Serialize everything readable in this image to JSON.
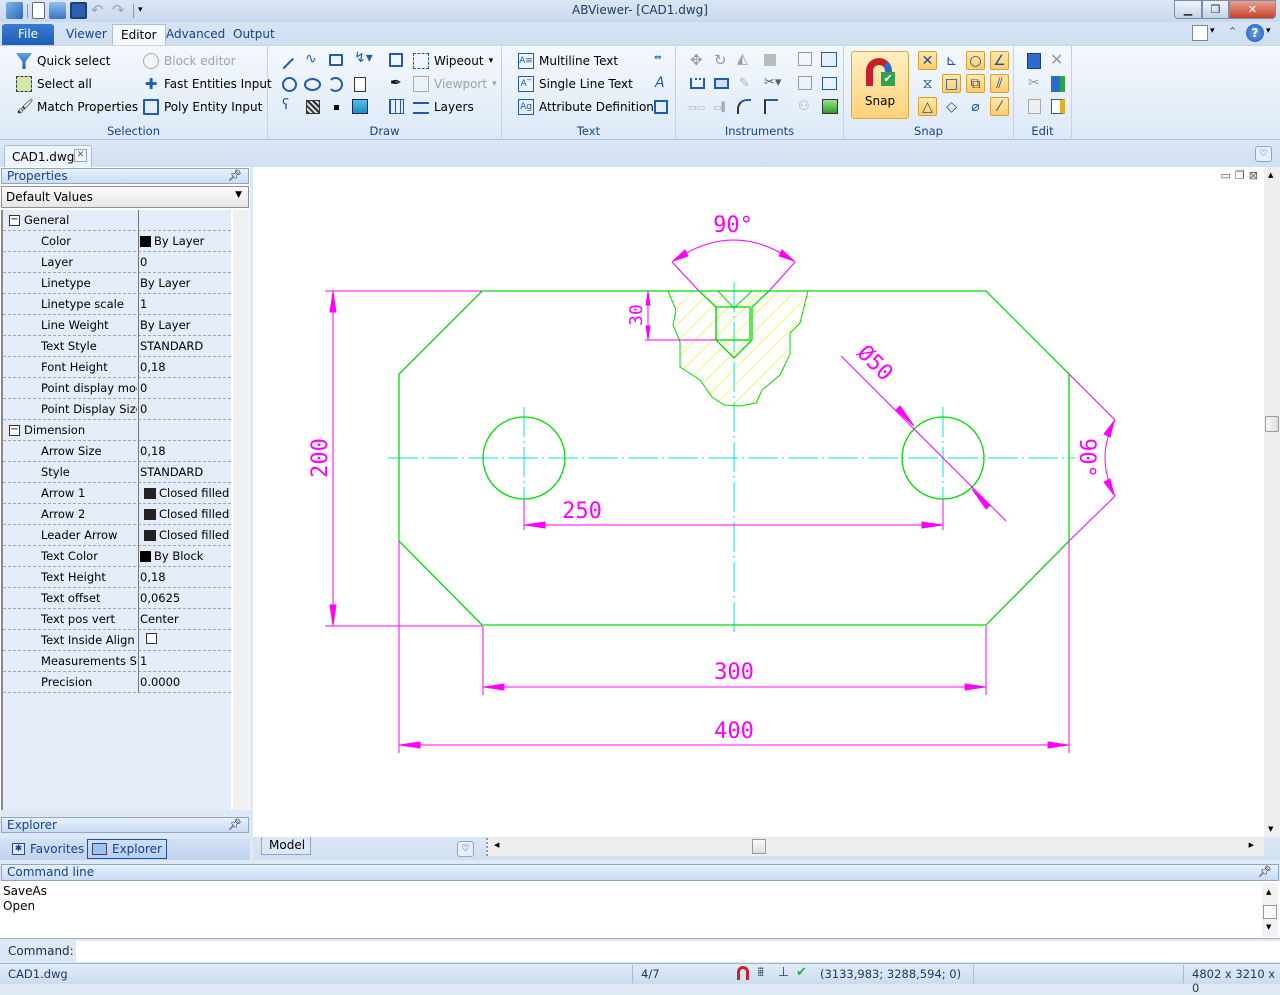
{
  "window": {
    "title": "ABViewer- [CAD1.dwg]",
    "controls": [
      "minimize",
      "restore",
      "close"
    ]
  },
  "quick_access": [
    "app-icon",
    "new-icon",
    "open-icon",
    "save-icon",
    "undo-icon",
    "redo-icon",
    "customize-icon"
  ],
  "ribbon_tabs": [
    {
      "label": "File"
    },
    {
      "label": "Viewer"
    },
    {
      "label": "Editor",
      "active": true
    },
    {
      "label": "Advanced"
    },
    {
      "label": "Output"
    }
  ],
  "ribbon": {
    "selection": {
      "label": "Selection",
      "items": [
        {
          "label": "Quick select",
          "icon": "filter-icon"
        },
        {
          "label": "Select all",
          "icon": "select-all-icon"
        },
        {
          "label": "Match Properties",
          "icon": "brush-icon"
        },
        {
          "label": "Block editor",
          "icon": "block-editor-icon",
          "disabled": true
        },
        {
          "label": "Fast Entities Input",
          "icon": "plus-icon"
        },
        {
          "label": "Poly Entity Input",
          "icon": "poly-input-icon"
        }
      ]
    },
    "draw": {
      "label": "Draw",
      "items": [
        {
          "label": "Wipeout",
          "icon": "wipeout-icon"
        },
        {
          "label": "Viewport",
          "icon": "viewport-icon",
          "disabled": true
        },
        {
          "label": "Layers",
          "icon": "layers-icon"
        }
      ]
    },
    "text": {
      "label": "Text",
      "items": [
        {
          "label": "Multiline Text",
          "icon": "mtext-icon"
        },
        {
          "label": "Single Line Text",
          "icon": "stext-icon"
        },
        {
          "label": "Attribute Definition",
          "icon": "attdef-icon"
        }
      ]
    },
    "instruments": {
      "label": "Instruments"
    },
    "snap": {
      "label": "Snap",
      "button": "Snap",
      "modes": [
        {
          "name": "intersection",
          "glyph": "✕",
          "on": true
        },
        {
          "name": "perpendicular",
          "glyph": "⊾",
          "on": false
        },
        {
          "name": "center",
          "glyph": "○",
          "on": true
        },
        {
          "name": "angle",
          "glyph": "∠",
          "on": true
        },
        {
          "name": "midpoint",
          "glyph": "⧖",
          "on": false
        },
        {
          "name": "square",
          "glyph": "□",
          "on": true
        },
        {
          "name": "overlap",
          "glyph": "⧉",
          "on": true
        },
        {
          "name": "parallel",
          "glyph": "⫽",
          "on": true
        },
        {
          "name": "triangle",
          "glyph": "△",
          "on": true
        },
        {
          "name": "quadrant",
          "glyph": "◇",
          "on": false
        },
        {
          "name": "tangent",
          "glyph": "⌀",
          "on": false
        },
        {
          "name": "nearest",
          "glyph": "⁄",
          "on": true
        }
      ]
    },
    "edit": {
      "label": "Edit"
    }
  },
  "document_tab": {
    "label": "CAD1.dwg"
  },
  "properties": {
    "title": "Properties",
    "selector": "Default Values",
    "categories": [
      {
        "name": "General",
        "rows": [
          {
            "key": "Color",
            "value": "By Layer",
            "swatch": "#000000"
          },
          {
            "key": "Layer",
            "value": "0"
          },
          {
            "key": "Linetype",
            "value": "By Layer"
          },
          {
            "key": "Linetype scale",
            "value": "1"
          },
          {
            "key": "Line Weight",
            "value": "By Layer"
          },
          {
            "key": "Text Style",
            "value": "STANDARD"
          },
          {
            "key": "Font Height",
            "value": "0,18"
          },
          {
            "key": "Point display mode",
            "value": "0"
          },
          {
            "key": "Point Display Size",
            "value": "0"
          }
        ]
      },
      {
        "name": "Dimension",
        "rows": [
          {
            "key": "Arrow Size",
            "value": "0,18"
          },
          {
            "key": "Style",
            "value": "STANDARD"
          },
          {
            "key": "Arrow 1",
            "value": "Closed filled",
            "arrow": true
          },
          {
            "key": "Arrow 2",
            "value": "Closed filled",
            "arrow": true
          },
          {
            "key": "Leader Arrow",
            "value": "Closed filled",
            "arrow": true
          },
          {
            "key": "Text Color",
            "value": "By Block",
            "swatch": "#000000"
          },
          {
            "key": "Text Height",
            "value": "0,18"
          },
          {
            "key": "Text offset",
            "value": "0,0625"
          },
          {
            "key": "Text pos vert",
            "value": "Center"
          },
          {
            "key": "Text Inside Align",
            "value": "",
            "checkbox": false
          },
          {
            "key": "Measurements Scale",
            "value": "1"
          },
          {
            "key": "Precision",
            "value": "0.0000"
          }
        ]
      }
    ]
  },
  "explorer": {
    "title": "Explorer"
  },
  "bottom_tabs": [
    {
      "label": "Favorites"
    },
    {
      "label": "Explorer",
      "active": true
    }
  ],
  "drawing": {
    "colors": {
      "outline": "#00dd00",
      "dimension": "#ff00ff",
      "centerline": "#00e5e5",
      "hatch": "#f0e000"
    },
    "dimensions": {
      "angle_top": "90°",
      "depth": "30",
      "height": "200",
      "hole_spacing": "250",
      "diameter": "Ø50",
      "angle_right": "90°",
      "bottom_width": "300",
      "total_width": "400"
    }
  },
  "layout_tabs": [
    {
      "label": "Model"
    }
  ],
  "command_line": {
    "title": "Command line",
    "history": [
      "SaveAs",
      "Open"
    ],
    "prompt": "Command:",
    "input_value": ""
  },
  "status": {
    "file": "CAD1.dwg",
    "page": "4/7",
    "coords": "(3133,983; 3288,594; 0)",
    "extents": "4802 x 3210 x 0"
  }
}
